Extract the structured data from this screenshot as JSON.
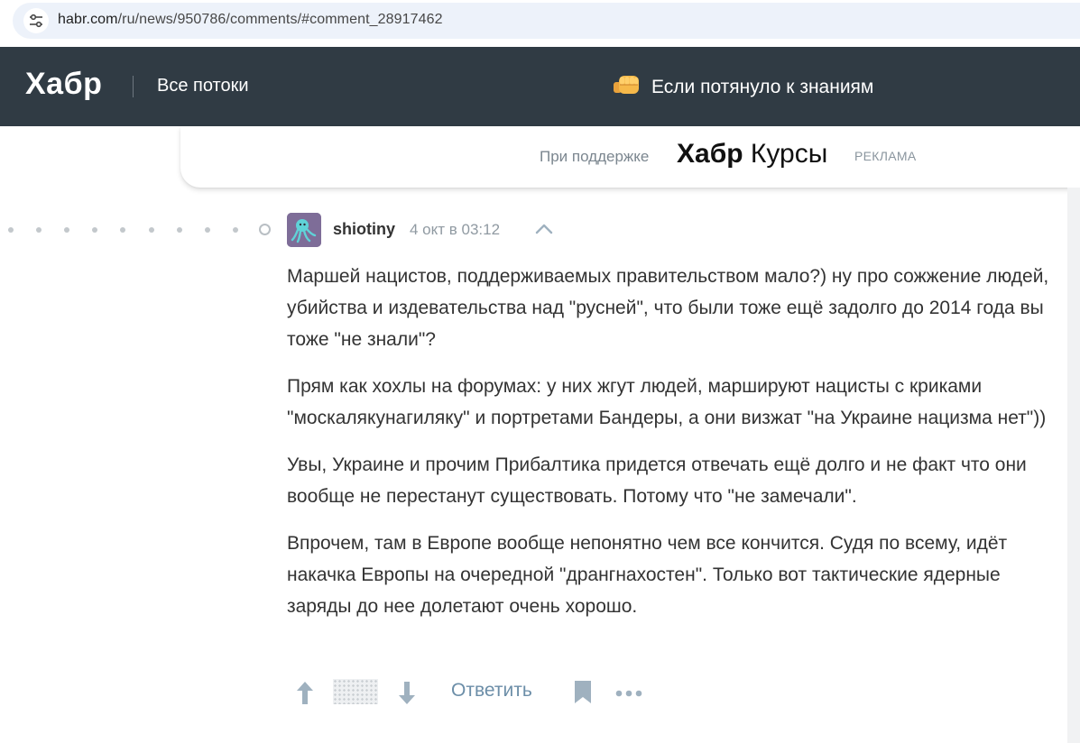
{
  "browser": {
    "url_host": "habr.com",
    "url_path": "/ru/news/950786/comments/#comment_28917462"
  },
  "header": {
    "logo": "Хабр",
    "nav_all_flows": "Все потоки",
    "promo_text": "Если потянуло к знаниям",
    "promo_icon": "fist-emoji-icon"
  },
  "ad": {
    "support_text": "При поддержке",
    "brand_bold": "Хабр",
    "brand_regular": " Курсы",
    "label": "РЕКЛАМА"
  },
  "comment": {
    "username": "shiotiny",
    "time": "4 окт в 03:12",
    "paragraphs": [
      "Маршей нацистов, поддерживаемых правительством мало?) ну про сожжение людей, убийства и издевательства над \"русней\", что были тоже ещё задолго до 2014 года вы тоже \"не знали\"?",
      "Прям как хохлы на форумах: у них жгут людей, маршируют нацисты с криками \"москалякунагиляку\" и портретами Бандеры, а они визжат \"на Украине нацизма нет\"))",
      "Увы, Украине и прочим Прибалтика придется отвечать ещё долго и не факт что они вообще не перестанут существовать. Потому что \"не замечали\".",
      "Впрочем, там в Европе вообще непонятно чем все кончится. Судя по всему, идёт накачка Европы на очередной \"дрангнахостен\". Только вот тактические ядерные заряды до нее долетают очень хорошо."
    ],
    "reply_label": "Ответить"
  },
  "colors": {
    "header_bg": "#303b44",
    "link_blue": "#6c8ea8",
    "icon_gray": "#9fb1bf"
  }
}
